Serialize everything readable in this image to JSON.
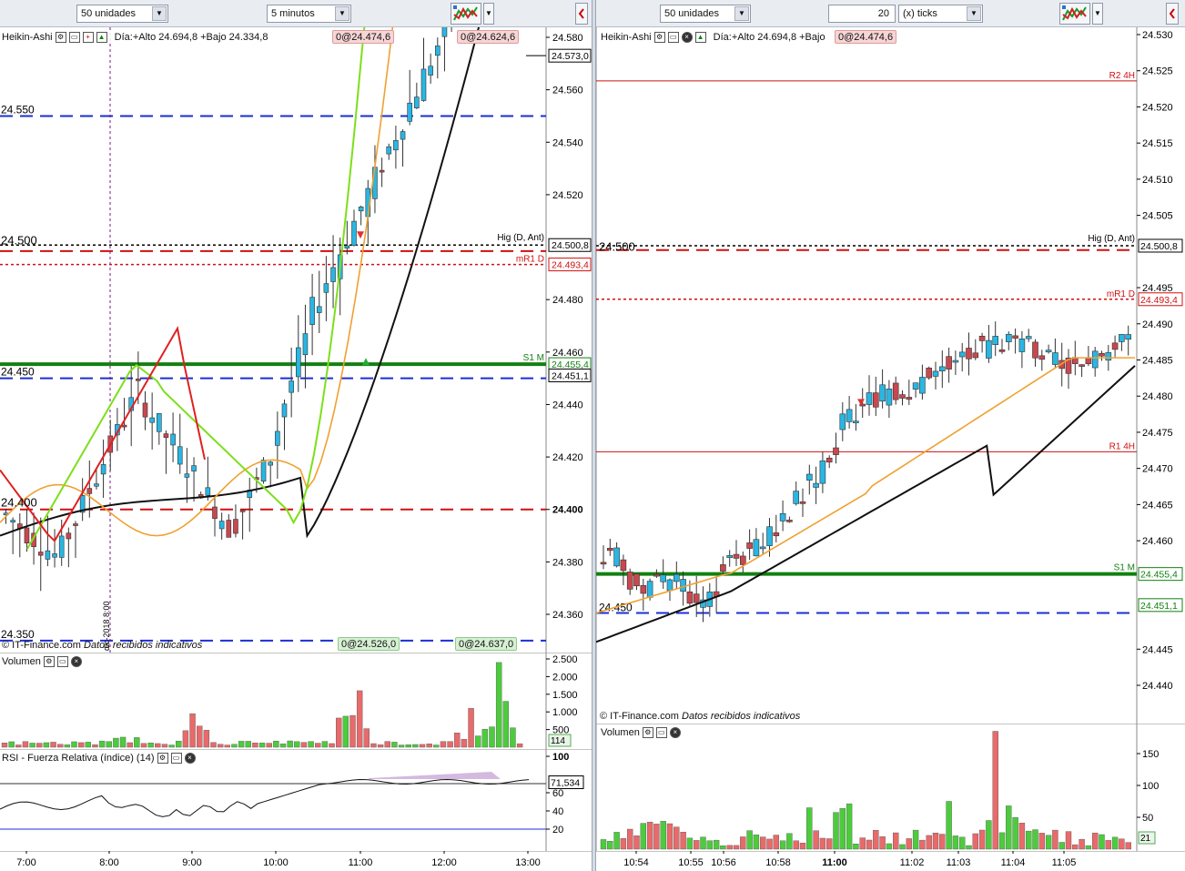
{
  "left": {
    "toolbar": {
      "units": "50 unidades",
      "timeframe": "5 minutos",
      "chart_icon": "chart-type-icon"
    },
    "main": {
      "title": "Heikin-Ashi",
      "day_info": "Día:+Alto 24.694,8 +Bajo 24.334,8",
      "box_top1": "0@24.474,6",
      "box_top2": "0@24.624,6",
      "box_bot1": "0@24.526,0",
      "box_bot2": "0@24.637,0",
      "y_ticks": [
        "24.580",
        "24.560",
        "24.540",
        "24.520",
        "24.500,8",
        "24.493,4",
        "24.480",
        "24.460",
        "24.455,4",
        "24.451,1",
        "24.440",
        "24.420",
        "24.400",
        "24.380",
        "24.360"
      ],
      "current_price": "24.573,0",
      "level_hig": "Hig (D, Ant)",
      "level_mr1": "mR1 D",
      "level_s1": "S1 M",
      "big_levels": [
        "24.550",
        "24.500",
        "24.450",
        "24.400",
        "24.350"
      ],
      "vertical_date": "dic-2018 8:00",
      "footer": "© IT-Finance.com",
      "footer_note": "Datos recibidos indicativos"
    },
    "volume": {
      "title": "Volumen",
      "y_ticks": [
        "2.500",
        "2.000",
        "1.500",
        "1.000",
        "500"
      ],
      "current": "114"
    },
    "rsi": {
      "title": "RSI - Fuerza Relativa (índice) (14)",
      "y_ticks": [
        "100",
        "60",
        "40",
        "20"
      ],
      "current": "71,534"
    },
    "x_ticks": [
      "7:00",
      "8:00",
      "9:00",
      "10:00",
      "11:00",
      "12:00",
      "13:00"
    ]
  },
  "right": {
    "toolbar": {
      "units": "50 unidades",
      "ticks_value": "20",
      "ticks_unit": "(x) ticks",
      "chart_icon": "chart-type-icon"
    },
    "main": {
      "title": "Heikin-Ashi",
      "day_info": "Día:+Alto 24.694,8 +Bajo",
      "box_top": "0@24.474,6",
      "y_ticks": [
        "24.530",
        "24.525",
        "24.520",
        "24.515",
        "24.510",
        "24.505",
        "24.500,8",
        "24.495",
        "24.493,4",
        "24.490",
        "24.485",
        "24.480",
        "24.475",
        "24.470",
        "24.465",
        "24.460",
        "24.455,4",
        "24.451,1",
        "24.445",
        "24.440"
      ],
      "level_r2": "R2 4H",
      "level_hig": "Hig (D, Ant)",
      "level_mr1": "mR1 D",
      "level_r1": "R1 4H",
      "level_s1": "S1 M",
      "big_levels": [
        "24.500",
        "24.450"
      ],
      "footer": "© IT-Finance.com",
      "footer_note": "Datos recibidos indicativos"
    },
    "volume": {
      "title": "Volumen",
      "y_ticks": [
        "150",
        "100",
        "50"
      ],
      "current": "21"
    },
    "x_ticks": [
      "10:54",
      "10:55",
      "10:56",
      "10:58",
      "11:00",
      "11:02",
      "11:03",
      "11:04",
      "11:05"
    ]
  },
  "colors": {
    "up": "#29b6e3",
    "down": "#c8484f",
    "vol_up": "#4ccc3c",
    "vol_down": "#e86a6a",
    "sma_fast": "#f0a030",
    "sma_slow": "#111111",
    "level_green": "#128012",
    "level_blue": "#1a2fd4",
    "level_red": "#d01010"
  }
}
